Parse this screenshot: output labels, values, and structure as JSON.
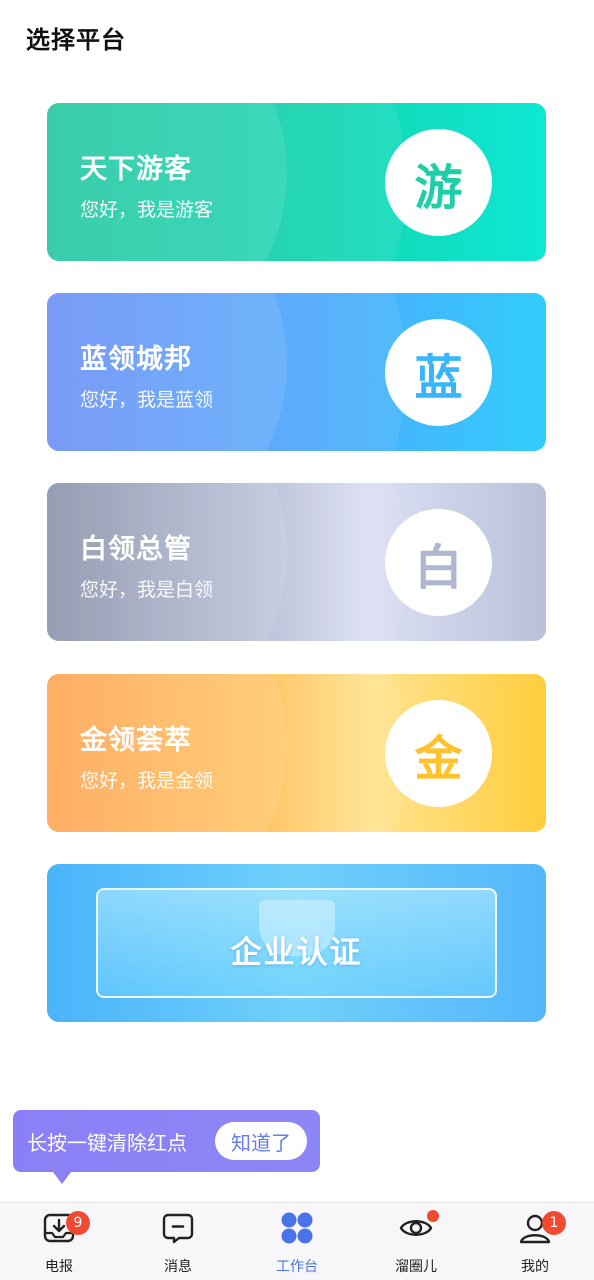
{
  "page": {
    "title": "选择平台"
  },
  "cards": [
    {
      "title": "天下游客",
      "subtitle": "您好，我是游客",
      "badge": "游",
      "badge_color": "#1ecfa8"
    },
    {
      "title": "蓝领城邦",
      "subtitle": "您好，我是蓝领",
      "badge": "蓝",
      "badge_color": "#37b6fb"
    },
    {
      "title": "白领总管",
      "subtitle": "您好，我是白领",
      "badge": "白",
      "badge_color": "#aeb6d0"
    },
    {
      "title": "金领荟萃",
      "subtitle": "您好，我是金领",
      "badge": "金",
      "badge_color": "#ffc22e"
    }
  ],
  "enterprise": {
    "label": "企业认证"
  },
  "tooltip": {
    "text": "长按一键清除红点",
    "button": "知道了"
  },
  "tabbar": {
    "items": [
      {
        "label": "电报",
        "icon": "telegram-icon",
        "badge": "9"
      },
      {
        "label": "消息",
        "icon": "message-icon"
      },
      {
        "label": "工作台",
        "icon": "workbench-icon",
        "active": true
      },
      {
        "label": "溜圈儿",
        "icon": "eye-icon",
        "dot": true
      },
      {
        "label": "我的",
        "icon": "profile-icon",
        "badge": "1"
      }
    ],
    "active_color": "#4a72ea"
  }
}
